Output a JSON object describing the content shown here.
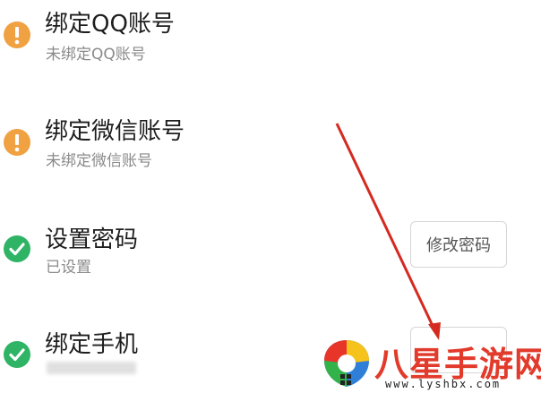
{
  "items": [
    {
      "title": "绑定QQ账号",
      "subtitle": "未绑定QQ账号",
      "status": "warning",
      "icon": "exclamation-icon"
    },
    {
      "title": "绑定微信账号",
      "subtitle": "未绑定微信账号",
      "status": "warning",
      "icon": "exclamation-icon"
    },
    {
      "title": "设置密码",
      "subtitle": "已设置",
      "status": "done",
      "icon": "check-icon",
      "action": "修改密码"
    },
    {
      "title": "绑定手机",
      "subtitle": "",
      "status": "done",
      "icon": "check-icon"
    }
  ],
  "watermark": {
    "brand": "八星手游网",
    "url": "www.lyshbx.com"
  },
  "colors": {
    "warning": "#f0a142",
    "done": "#2fb466",
    "arrow": "#d42a1f",
    "watermark": "#e23b2b"
  }
}
